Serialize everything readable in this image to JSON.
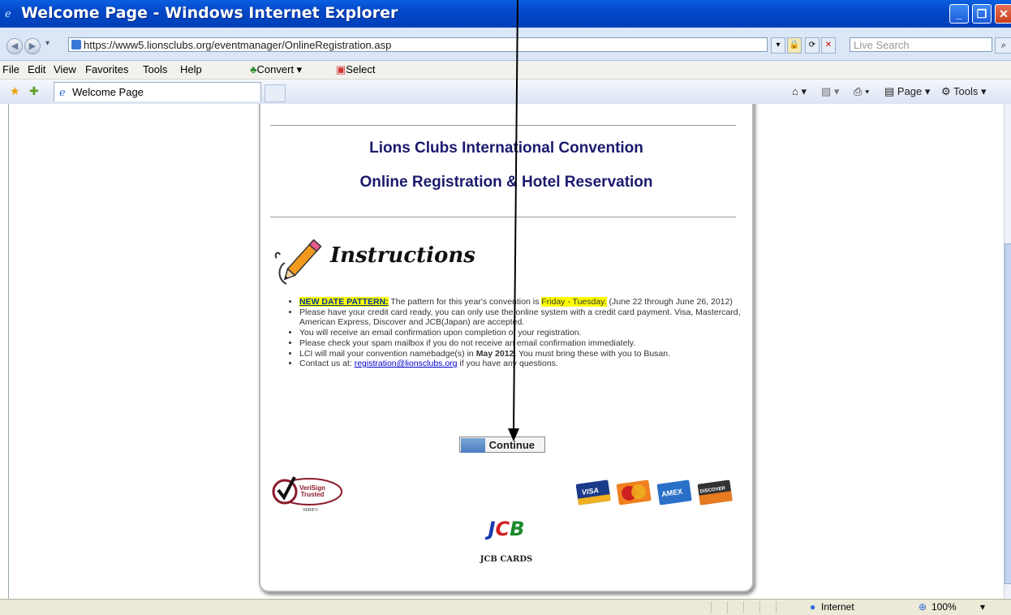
{
  "window": {
    "title": "Welcome Page - Windows Internet Explorer"
  },
  "address": {
    "url": "https://www5.lionsclubs.org/eventmanager/OnlineRegistration.asp",
    "search_placeholder": "Live Search"
  },
  "menu": {
    "items": [
      "File",
      "Edit",
      "View",
      "Favorites",
      "Tools",
      "Help"
    ],
    "convert": "Convert",
    "select": "Select"
  },
  "tab": {
    "label": "Welcome Page"
  },
  "commands": {
    "page": "Page",
    "tools": "Tools"
  },
  "page": {
    "heading1": "Lions Clubs International Convention",
    "heading2": "Online Registration & Hotel Reservation",
    "instructions_title": "Instructions",
    "bullets": {
      "b1_label": "NEW DATE PATTERN:",
      "b1_text": " The pattern for this year's convention is ",
      "b1_highlight": "Friday - Tuesday.",
      "b1_tail": " (June 22 through June 26, 2012)",
      "b2": "Please have your credit card ready, you can only use the online system with a credit card payment. Visa, Mastercard, American Express, Discover and JCB(Japan) are accepted.",
      "b3": "You will receive an email confirmation upon completion of your registration.",
      "b4": "Please check your spam mailbox if you do not receive an email confirmation immediately.",
      "b5_a": "LCI will mail your convention namebadge(s) in ",
      "b5_bold": "May 2012.",
      "b5_b": " You must bring these with you to Busan.",
      "b6_a": "Contact us at: ",
      "b6_link": "registration@lionsclubs.org",
      "b6_b": " if you have any questions."
    },
    "continue_label": "Continue",
    "verisign": {
      "line1": "VeriSign",
      "line2": "Trusted",
      "line3": "VERIFY"
    },
    "cards": [
      "VISA",
      "MasterCard",
      "AMEX",
      "DISCOVER"
    ],
    "jcb_logo": "JCB",
    "jcb_caption": "JCB CARDS"
  },
  "status": {
    "zone": "Internet",
    "zoom": "100%"
  }
}
